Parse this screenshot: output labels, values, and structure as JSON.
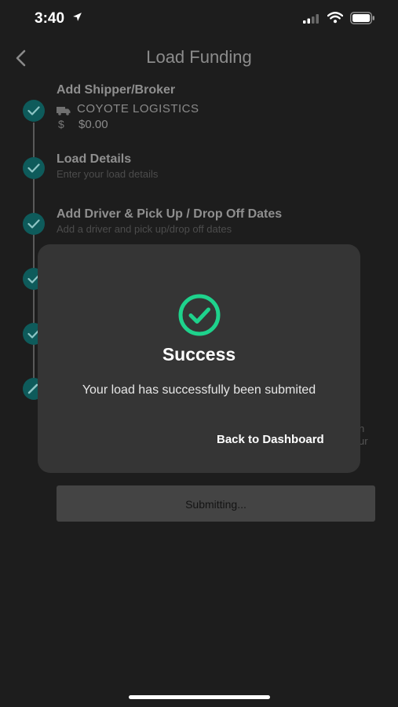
{
  "status_bar": {
    "time": "3:40",
    "icons": [
      "location-arrow-icon",
      "cellular-signal-icon",
      "wifi-icon",
      "battery-icon"
    ]
  },
  "header": {
    "back_icon": "chevron-left-icon",
    "title": "Load Funding"
  },
  "steps": [
    {
      "title": "Add Shipper/Broker",
      "state": "complete",
      "shipper": "COYOTE LOGISTICS",
      "shipper_icon": "truck-icon",
      "amount_icon": "dollar-icon",
      "amount_symbol": "$",
      "amount": "$0.00"
    },
    {
      "title": "Load Details",
      "subtitle": "Enter your load details",
      "state": "complete"
    },
    {
      "title": "Add Driver & Pick Up / Drop Off Dates",
      "subtitle": "Add a driver and pick up/drop off dates",
      "state": "complete"
    },
    {
      "state": "complete"
    },
    {
      "state": "complete"
    },
    {
      "state": "in-progress"
    }
  ],
  "obscured_text_fragments": [
    "n",
    "ur"
  ],
  "submit_button": {
    "label": "Submitting..."
  },
  "modal": {
    "icon": "check-circle-icon",
    "title": "Success",
    "message": "Your load has successfully been submited",
    "action_label": "Back to Dashboard"
  },
  "colors": {
    "background": "#1d1d1d",
    "modal_background": "#353535",
    "accent_green": "#1ed28c",
    "step_teal": "#0e5b5b"
  }
}
